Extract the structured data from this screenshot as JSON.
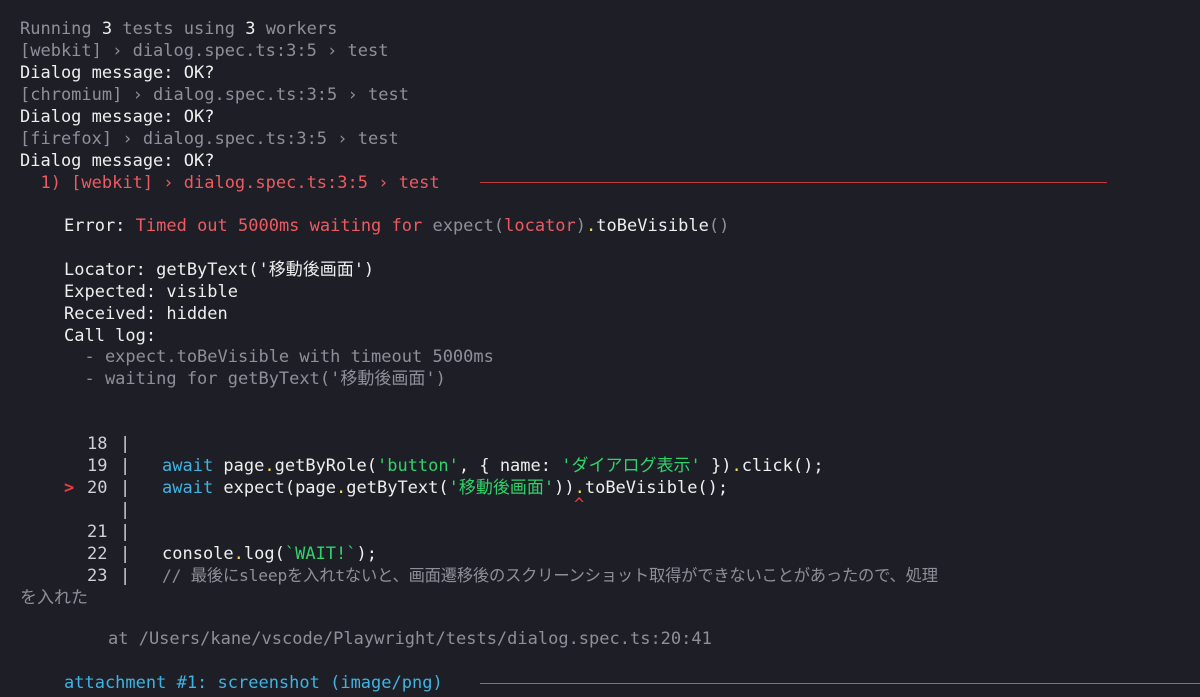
{
  "header": {
    "running_prefix": "Running ",
    "running_count": "3",
    "running_mid": " tests using ",
    "worker_count": "3",
    "running_suffix": " workers"
  },
  "runs": [
    {
      "project": "[webkit] › dialog.spec.ts:3:5 › test",
      "message": "Dialog message: OK?"
    },
    {
      "project": "[chromium] › dialog.spec.ts:3:5 › test",
      "message": "Dialog message: OK?"
    },
    {
      "project": "[firefox] › dialog.spec.ts:3:5 › test",
      "message": "Dialog message: OK?"
    }
  ],
  "failure": {
    "title": "  1) [webkit] › dialog.spec.ts:3:5 › test ",
    "error_label": "Error: ",
    "error_text": "Timed out 5000ms waiting for ",
    "expect_a": "expect(",
    "expect_locator": "locator",
    "expect_b": ")",
    "expect_dot": ".",
    "expect_method": "toBeVisible",
    "expect_parens": "()",
    "locator_line": "Locator: getByText('移動後画面')",
    "expected_line": "Expected: visible",
    "received_line": "Received: hidden",
    "calllog_line": "Call log:",
    "calllog_items": [
      "  - expect.toBeVisible with timeout 5000ms",
      "  - waiting for getByText('移動後画面')"
    ]
  },
  "code": {
    "marker": ">",
    "lines": [
      {
        "num": "18",
        "sep": "|"
      },
      {
        "num": "19",
        "sep": "|"
      },
      {
        "num": "20",
        "sep": "|"
      },
      {
        "num": "",
        "sep": "|"
      },
      {
        "num": "21",
        "sep": "|"
      },
      {
        "num": "22",
        "sep": "|"
      },
      {
        "num": "23",
        "sep": "|"
      }
    ],
    "l19": {
      "kw_await": "await",
      "sp1": " page",
      "dot1": ".",
      "call1": "getByRole(",
      "str1": "'button'",
      "comma": ", { name: ",
      "str2": "'ダイアログ表示'",
      "close": " })",
      "dot2": ".",
      "call2": "click();"
    },
    "l20": {
      "kw_await": "await",
      "sp1": " expect(page",
      "dot1": ".",
      "call1": "getByText(",
      "str1": "'移動後画面'",
      "close": "))",
      "dot2": ".",
      "call2": "toBeVisible();"
    },
    "caret": "^",
    "l22": {
      "obj": "console",
      "dot": ".",
      "call": "log(",
      "str": "`WAIT!`",
      "close": ");"
    },
    "l23_comment": "// 最後にsleepを入れtないと、画面遷移後のスクリーンショット取得ができないことがあったので、処理",
    "l23_wrap": "を入れた"
  },
  "stack": {
    "at_line": "at /Users/kane/vscode/Playwright/tests/dialog.spec.ts:20:41"
  },
  "attachment": {
    "label": "attachment #1: screenshot (image/png) "
  }
}
